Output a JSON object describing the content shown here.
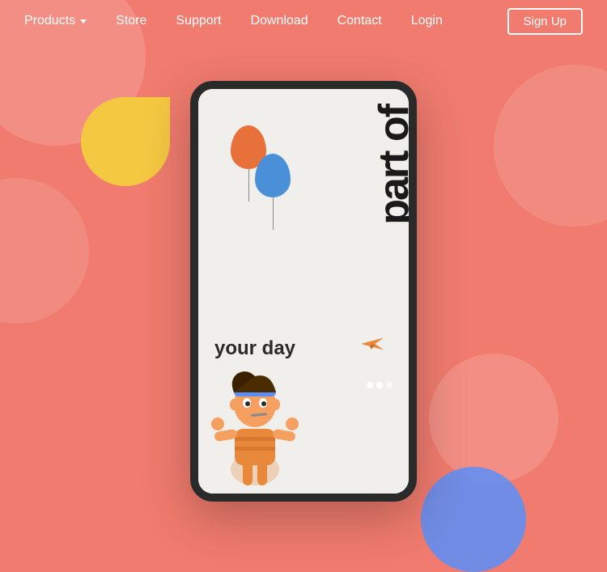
{
  "nav": {
    "items": [
      {
        "label": "Products",
        "hasDropdown": true
      },
      {
        "label": "Store",
        "hasDropdown": false
      },
      {
        "label": "Support",
        "hasDropdown": false
      },
      {
        "label": "Download",
        "hasDropdown": false
      },
      {
        "label": "Contact",
        "hasDropdown": false
      },
      {
        "label": "Login",
        "hasDropdown": false
      }
    ],
    "signup_label": "Sign Up"
  },
  "hero": {
    "vertical_text": "part of",
    "your_day_text": "your day"
  },
  "colors": {
    "bg": "#F07B6E",
    "nav_text": "#ffffff",
    "device_border": "#2a2a2a",
    "screen_bg": "#F0EFEB",
    "yellow_shape": "#F5C842",
    "balloon_orange": "#E8703A",
    "balloon_blue": "#4A90D9",
    "circle_accent": "#5B8FF9"
  }
}
